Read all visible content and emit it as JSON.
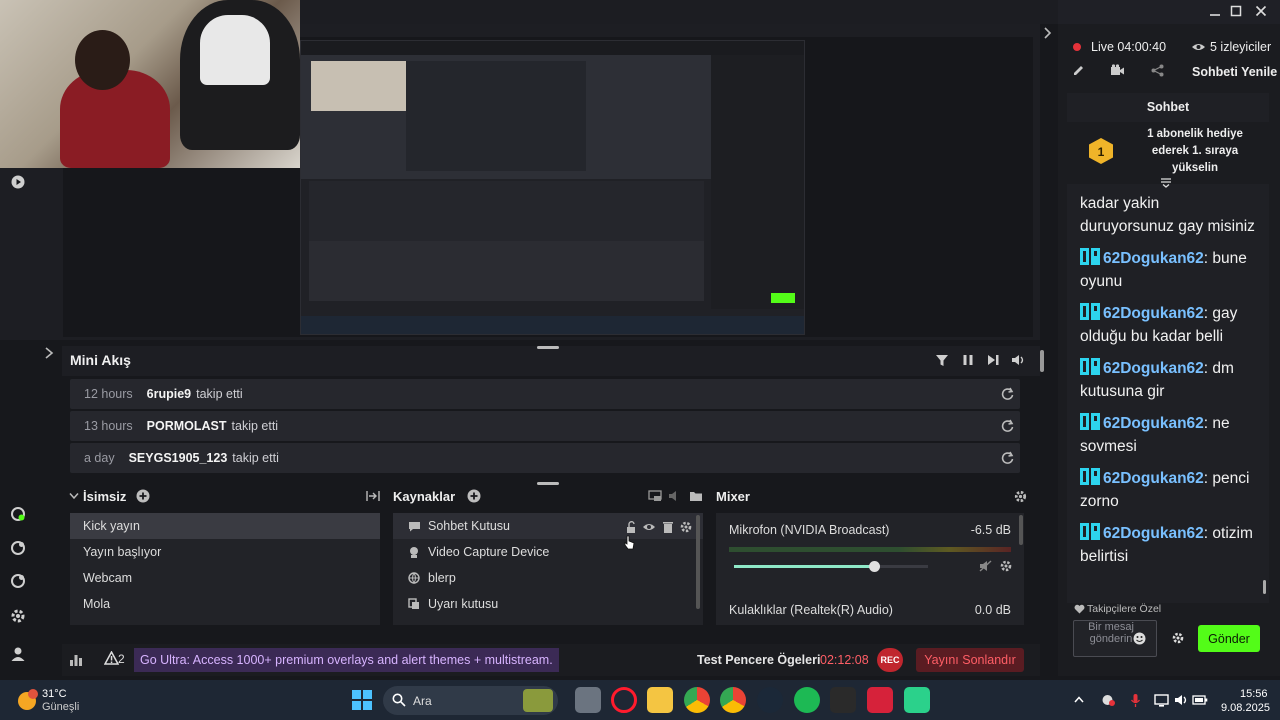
{
  "stream": {
    "live_label": "Live 04:00:40",
    "viewers": "5 izleyiciler",
    "refresh_chat": "Sohbeti Yenile"
  },
  "mini_feed": {
    "title": "Mini Akış",
    "rows": [
      {
        "time": "12 hours",
        "user": "6rupie9",
        "action": "takip etti"
      },
      {
        "time": "13 hours",
        "user": "PORMOLAST",
        "action": "takip etti"
      },
      {
        "time": "a day",
        "user": "SEYGS1905_123",
        "action": "takip etti"
      }
    ]
  },
  "scenes": {
    "title": "İsimsiz",
    "items": [
      "Kick yayın",
      "Yayın başlıyor",
      "Webcam",
      "Mola"
    ]
  },
  "sources": {
    "title": "Kaynaklar",
    "items": [
      "Sohbet Kutusu",
      "Video Capture Device",
      "blerp",
      "Uyarı kutusu"
    ]
  },
  "mixer": {
    "title": "Mixer",
    "channels": [
      {
        "name": "Mikrofon (NVIDIA Broadcast)",
        "db": "-6.5 dB",
        "level": 0.72
      },
      {
        "name": "Kulaklıklar (Realtek(R) Audio)",
        "db": "0.0 dB"
      }
    ]
  },
  "statusbar": {
    "alert_count": "2",
    "banner": "Go Ultra: Access 1000+ premium overlays and alert themes + multistream.",
    "test_label": "Test Pencere Ögeleri",
    "timer": "02:12:08",
    "rec": "REC",
    "end_stream": "Yayını Sonlandır"
  },
  "chat": {
    "title": "Sohbet",
    "pinned": "1 abonelik hediye ederek 1. sıraya yükselin",
    "first_message": "kadar yakin duruyorsunuz gay misiniz",
    "messages": [
      {
        "user": "62Dogukan62",
        "text": "bune oyunu"
      },
      {
        "user": "62Dogukan62",
        "text": "gay olduğu bu kadar belli"
      },
      {
        "user": "62Dogukan62",
        "text": "dm kutusuna gir"
      },
      {
        "user": "62Dogukan62",
        "text": "ne sovmesi"
      },
      {
        "user": "62Dogukan62",
        "text": "penci zorno"
      },
      {
        "user": "62Dogukan62",
        "text": "otizim belirtisi"
      }
    ],
    "followers_only": "Takipçilere Özel",
    "input_placeholder": "Bir mesaj gönderin",
    "send": "Gönder"
  },
  "taskbar": {
    "weather_temp": "31°C",
    "weather_desc": "Güneşli",
    "search_placeholder": "Ara",
    "time": "15:56",
    "date": "9.08.2025"
  },
  "colors": {
    "accent_green": "#53fc18",
    "live_red": "#e5323a",
    "chat_user": "#79c0ff"
  }
}
